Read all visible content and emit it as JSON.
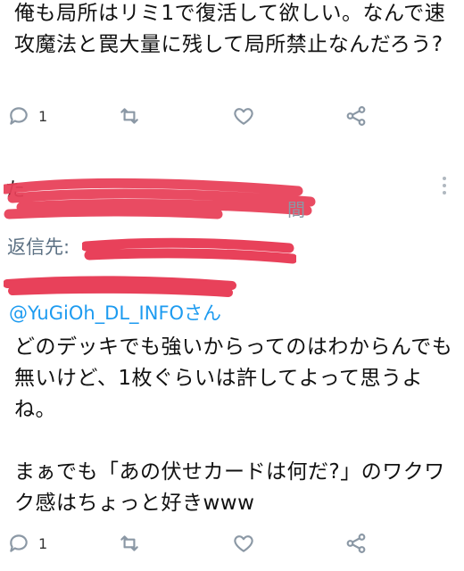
{
  "tweet1": {
    "text": "俺も局所はリミ1で復活して欲しい。なんで速攻魔法と罠大量に残して局所禁止なんだろう?",
    "reply_count": "1"
  },
  "tweet2": {
    "reply_prefix": "返信先:",
    "mention": "@YuGiOh_DL_INFOさん",
    "text": "どのデッキでも強いからってのはわからんでも無いけど、1枚ぐらいは許してよって思うよね。\n\nまぁでも「あの伏せカードは何だ?」のワクワク感はちょっと好きwww",
    "reply_count": "1"
  },
  "icons": {
    "reply": "reply-icon",
    "retweet": "retweet-icon",
    "like": "heart-icon",
    "share": "share-icon",
    "more": "more-vertical-icon"
  },
  "colors": {
    "icon_gray": "#8b98a5",
    "link_blue": "#1d9bf0",
    "redaction_red": "#e8415a"
  }
}
